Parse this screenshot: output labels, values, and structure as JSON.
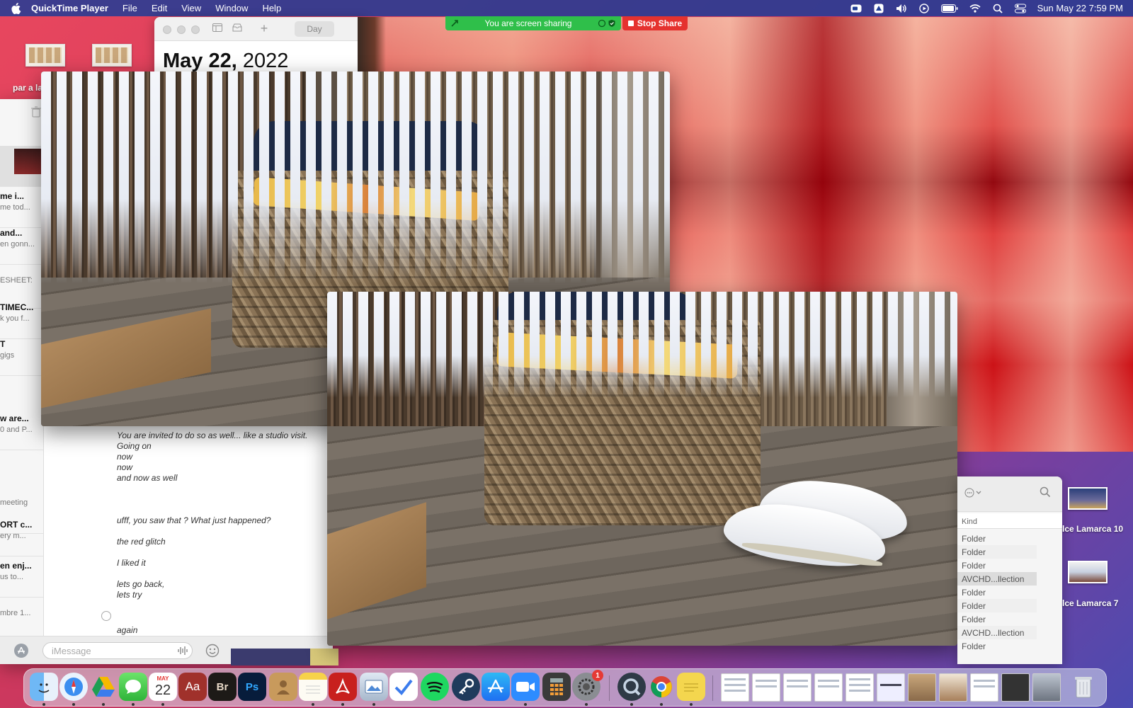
{
  "menubar": {
    "app_name": "QuickTime Player",
    "menus": [
      "File",
      "Edit",
      "View",
      "Window",
      "Help"
    ],
    "clock": "Sun May 22  7:59 PM"
  },
  "desktop_left": {
    "label": "par a la"
  },
  "calendar": {
    "view_button": "Day",
    "date_bold": "May 22,",
    "date_year": " 2022"
  },
  "screen_share": {
    "banner_text": "You are screen sharing",
    "stop_label": "Stop Share"
  },
  "messages": {
    "conversations": [
      {
        "name": "",
        "preview": ""
      },
      {
        "name": "me i...",
        "preview": "me tod..."
      },
      {
        "name": "and...",
        "preview": "en gonn..."
      },
      {
        "name": "ESHEET:",
        "preview": ""
      },
      {
        "name": "TIMEC...",
        "preview": "k you f..."
      },
      {
        "name": "T",
        "preview": "gigs"
      },
      {
        "name": "",
        "preview": ""
      },
      {
        "name": "w are...",
        "preview": "0 and P..."
      },
      {
        "name": "",
        "preview": ""
      },
      {
        "name": "",
        "preview": "meeting"
      },
      {
        "name": "ORT c...",
        "preview": "ery m..."
      },
      {
        "name": "en enj...",
        "preview": "us to..."
      },
      {
        "name": "",
        "preview": "mbre 1..."
      }
    ],
    "lines": [
      "You are invited to do so as well... like a studio visit.",
      "Going on",
      "now",
      "now",
      "and now as well",
      "ufff, you saw that ? What just happened?",
      "the red glitch",
      "I liked it",
      "lets go back,",
      "lets try",
      "again"
    ],
    "input_placeholder": "iMessage"
  },
  "finder": {
    "kind_header": "Kind",
    "rows": [
      "Folder",
      "Folder",
      "Folder",
      "AVCHD...llection",
      "Folder",
      "Folder",
      "Folder",
      "AVCHD...llection",
      "Folder"
    ],
    "selected_index": 3
  },
  "desktop_right": {
    "items": [
      "lce Lamarca 10",
      "lce Lamarca 7"
    ]
  },
  "dock": {
    "calendar_month": "MAY",
    "calendar_day": "22",
    "system_prefs_badge": "1",
    "apps": [
      "finder-icon",
      "safari-icon",
      "google-drive-icon",
      "messages-icon",
      "calendar-icon",
      "dictionary-icon",
      "bridge-icon",
      "photoshop-icon",
      "contacts-icon",
      "notes-icon",
      "acrobat-icon",
      "preview-icon",
      "tasks-icon",
      "spotify-icon",
      "keychain-icon",
      "app-store-icon",
      "zoom-icon",
      "calculator-icon",
      "system-preferences-icon",
      "quicktime-icon",
      "chrome-icon",
      "stickies-icon"
    ],
    "labels": {
      "dictionary": "Aa",
      "bridge": "Br",
      "photoshop": "Ps"
    }
  },
  "colors": {
    "share_green": "#2fbf4a",
    "stop_red": "#e5322f",
    "menubar": "#1e3c96"
  }
}
